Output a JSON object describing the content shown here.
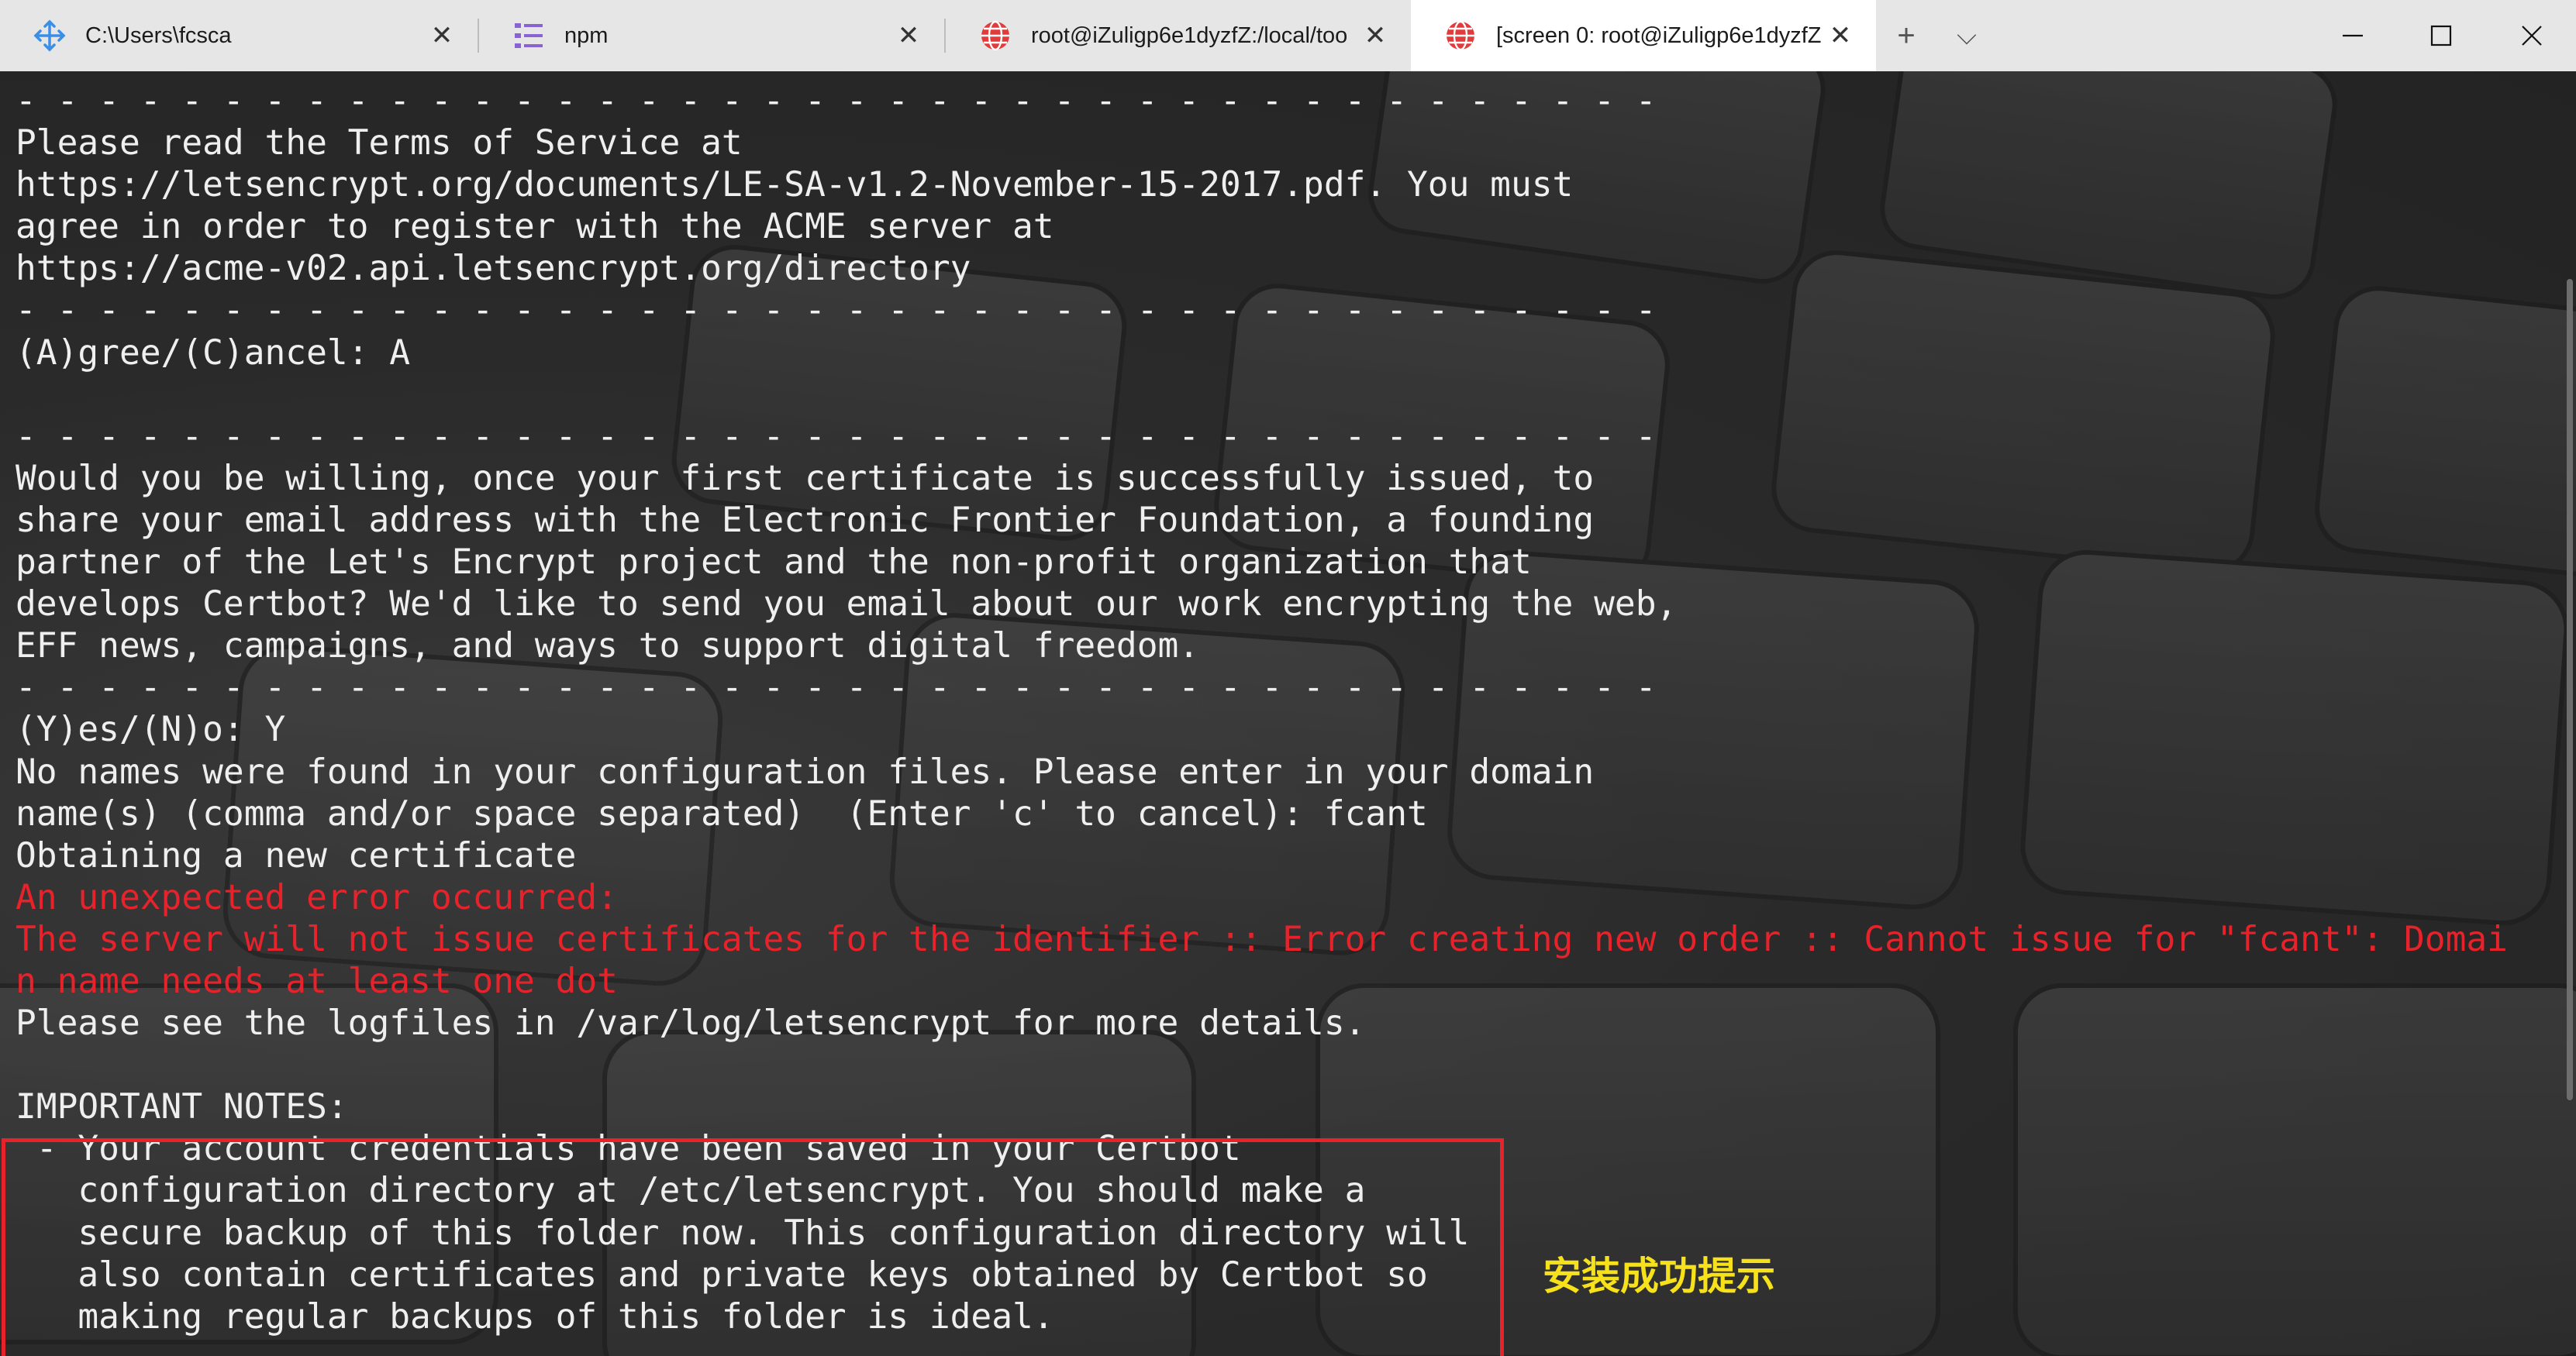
{
  "tabs": [
    {
      "title": "C:\\Users\\fcsca",
      "icon": "azure-arrows-icon",
      "active": false
    },
    {
      "title": "npm",
      "icon": "list-icon",
      "active": false
    },
    {
      "title": "root@iZuligp6e1dyzfZ:/local/too",
      "icon": "globe-icon",
      "active": false
    },
    {
      "title": "[screen 0: root@iZuligp6e1dyzfZ",
      "icon": "globe-icon",
      "active": true
    }
  ],
  "tabbar": {
    "new_tab_symbol": "+",
    "dropdown_symbol": "⌵",
    "close_symbol": "✕"
  },
  "terminal": {
    "lines": [
      {
        "text": "- - - - - - - - - - - - - - - - - - - - - - - - - - - - - - - - - - - - - - - -",
        "error": false
      },
      {
        "text": "Please read the Terms of Service at",
        "error": false
      },
      {
        "text": "https://letsencrypt.org/documents/LE-SA-v1.2-November-15-2017.pdf. You must",
        "error": false
      },
      {
        "text": "agree in order to register with the ACME server at",
        "error": false
      },
      {
        "text": "https://acme-v02.api.letsencrypt.org/directory",
        "error": false
      },
      {
        "text": "- - - - - - - - - - - - - - - - - - - - - - - - - - - - - - - - - - - - - - - -",
        "error": false
      },
      {
        "text": "(A)gree/(C)ancel: A",
        "error": false
      },
      {
        "text": "",
        "error": false
      },
      {
        "text": "- - - - - - - - - - - - - - - - - - - - - - - - - - - - - - - - - - - - - - - -",
        "error": false
      },
      {
        "text": "Would you be willing, once your first certificate is successfully issued, to",
        "error": false
      },
      {
        "text": "share your email address with the Electronic Frontier Foundation, a founding",
        "error": false
      },
      {
        "text": "partner of the Let's Encrypt project and the non-profit organization that",
        "error": false
      },
      {
        "text": "develops Certbot? We'd like to send you email about our work encrypting the web,",
        "error": false
      },
      {
        "text": "EFF news, campaigns, and ways to support digital freedom.",
        "error": false
      },
      {
        "text": "- - - - - - - - - - - - - - - - - - - - - - - - - - - - - - - - - - - - - - - -",
        "error": false
      },
      {
        "text": "(Y)es/(N)o: Y",
        "error": false
      },
      {
        "text": "No names were found in your configuration files. Please enter in your domain",
        "error": false
      },
      {
        "text": "name(s) (comma and/or space separated)  (Enter 'c' to cancel): fcant",
        "error": false
      },
      {
        "text": "Obtaining a new certificate",
        "error": false
      },
      {
        "text": "An unexpected error occurred:",
        "error": true
      },
      {
        "text": "The server will not issue certificates for the identifier :: Error creating new order :: Cannot issue for \"fcant\": Domai",
        "error": true
      },
      {
        "text": "n name needs at least one dot",
        "error": true
      },
      {
        "text": "Please see the logfiles in /var/log/letsencrypt for more details.",
        "error": false
      },
      {
        "text": "",
        "error": false
      },
      {
        "text": "IMPORTANT NOTES:",
        "error": false
      },
      {
        "text": " - Your account credentials have been saved in your Certbot",
        "error": false
      },
      {
        "text": "   configuration directory at /etc/letsencrypt. You should make a",
        "error": false
      },
      {
        "text": "   secure backup of this folder now. This configuration directory will",
        "error": false
      },
      {
        "text": "   also contain certificates and private keys obtained by Certbot so",
        "error": false
      },
      {
        "text": "   making regular backups of this folder is ideal.",
        "error": false
      }
    ]
  },
  "annotation": {
    "text": "安装成功提示",
    "color": "#f7e11b"
  },
  "colors": {
    "error_text": "#e8222a",
    "highlight_border": "#e8222a",
    "terminal_text": "#efefef"
  }
}
